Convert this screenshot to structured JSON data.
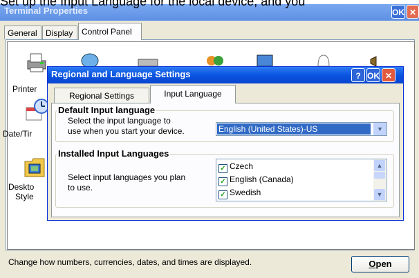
{
  "caption": "Set up the Input Language for the local device, and you",
  "outer": {
    "title": "Terminal Properties",
    "ok_label": "OK",
    "close_label": "✕",
    "tabs": [
      "General",
      "Display",
      "Control Panel"
    ],
    "control_items": [
      {
        "label": "Printer",
        "icon": "printer-icon"
      },
      {
        "label": "Date/Tir",
        "icon": "date-time-icon"
      },
      {
        "label": "Deskto\nStyle",
        "icon": "desktop-style-icon"
      }
    ],
    "status_text": "Change how numbers, currencies, dates, and times are displayed.",
    "open_label_u": "O",
    "open_label_rest": "pen"
  },
  "dialog": {
    "title": "Regional and Language Settings",
    "help_label": "?",
    "ok_label": "OK",
    "close_label": "✕",
    "tabs": [
      "Regional Settings",
      "Input Language"
    ],
    "default_group": {
      "title": "Default Input language",
      "description_line1": "Select the input language to",
      "description_line2": "use when you start your device.",
      "selected_value": "English (United States)-US"
    },
    "installed_group": {
      "title": "Installed Input Languages",
      "description_line1": "Select input languages you plan",
      "description_line2": "to use.",
      "languages": [
        {
          "name": "Czech",
          "checked": true
        },
        {
          "name": "English (Canada)",
          "checked": true
        },
        {
          "name": "Swedish",
          "checked": true
        }
      ]
    }
  },
  "colors": {
    "dialog_title_bar": "#0a54e0",
    "selection": "#316ac5",
    "window_face": "#ece9d8"
  }
}
